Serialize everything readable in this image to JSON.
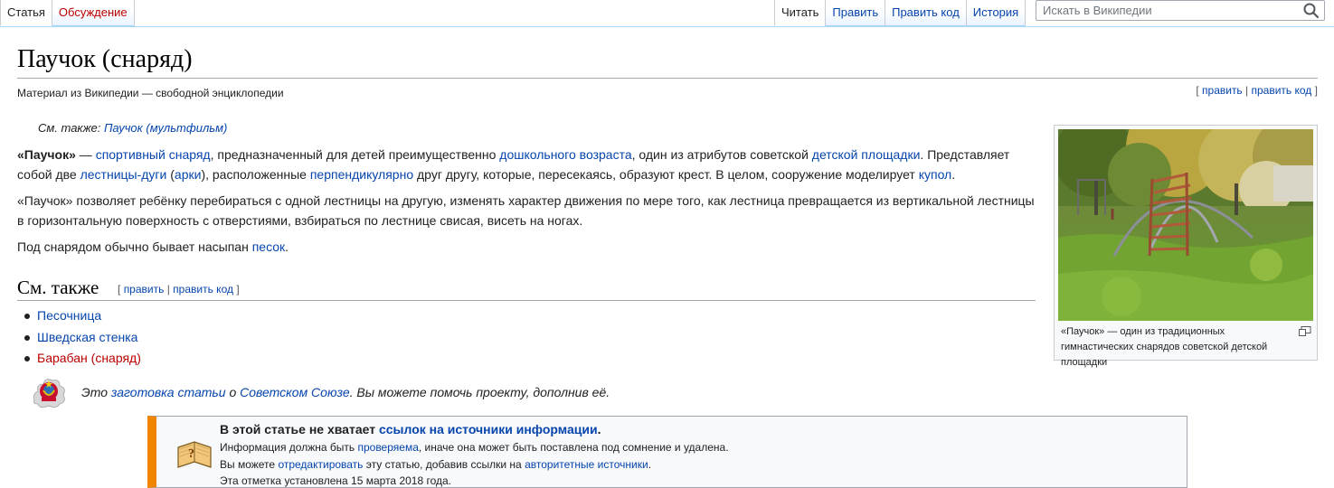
{
  "tabs_left": [
    {
      "label": "Статья",
      "selected": true
    },
    {
      "label": "Обсуждение",
      "selected": false
    }
  ],
  "tabs_right": [
    {
      "label": "Читать",
      "selected": true
    },
    {
      "label": "Править",
      "selected": false
    },
    {
      "label": "Править код",
      "selected": false
    },
    {
      "label": "История",
      "selected": false
    }
  ],
  "search": {
    "placeholder": "Искать в Википедии",
    "icon": "search-icon"
  },
  "article": {
    "title": "Паучок (снаряд)",
    "tagline": "Материал из Википедии — свободной энциклопедии",
    "edit_links": {
      "open": "[",
      "edit": "править",
      "sep": "|",
      "edit_code": "править код",
      "close": "]"
    },
    "hatnote": {
      "prefix": "См. также: ",
      "link": "Паучок (мультфильм)"
    },
    "p1": {
      "bold": "«Паучок»",
      "t1": " — ",
      "l1": "спортивный снаряд",
      "t2": ", предназначенный для детей преимущественно ",
      "l2": "дошкольного возраста",
      "t3": ", один из атрибутов советской ",
      "l3": "детской площадки",
      "t4": ". Представляет собой две ",
      "l4": "лестницы-дуги",
      "t5": " (",
      "l5": "арки",
      "t6": "), расположенные ",
      "l6": "перпендикулярно",
      "t7": " друг другу, которые, пересекаясь, образуют крест. В целом, сооружение моделирует ",
      "l7": "купол",
      "t8": "."
    },
    "p2": "«Паучок» позволяет ребёнку перебираться с одной лестницы на другую, изменять характер движения по мере того, как лестница превращается из вертикальной лестницы в горизонтальную поверхность с отверстиями, взбираться по лестнице свисая, висеть на ногах.",
    "p3": {
      "t1": "Под снарядом обычно бывает насыпан ",
      "l1": "песок",
      "t2": "."
    },
    "see_also": {
      "heading": "См. также",
      "items": [
        {
          "label": "Песочница",
          "exists": true
        },
        {
          "label": "Шведская стенка",
          "exists": true
        },
        {
          "label": "Барабан (снаряд)",
          "exists": false
        }
      ]
    },
    "stub": {
      "t1": "Это ",
      "l1": "заготовка статьи",
      "t2": " о ",
      "l2": "Советском Союзе",
      "t3": ". Вы можете помочь проекту, дополнив её."
    },
    "ambox": {
      "title_prefix": "В этой статье не хватает ",
      "title_link": "ссылок на источники информации",
      "title_suffix": ".",
      "line1_t1": "Информация должна быть ",
      "line1_link": "проверяема",
      "line1_t2": ", иначе она может быть поставлена под сомнение и удалена.",
      "line2_t1": "Вы можете ",
      "line2_link": "отредактировать",
      "line2_t2": " эту статью, добавив ссылки на ",
      "line2_link2": "авторитетные источники",
      "line2_t3": ".",
      "line3": "Эта отметка установлена 15 марта 2018 года."
    },
    "thumb": {
      "caption": "«Паучок» — один из традиционных гимнастических снарядов советской детской площадки",
      "enlarge_icon": "enlarge-icon"
    }
  },
  "colors": {
    "link": "#0645ad",
    "redlink": "#ba0000",
    "ambox_accent": "#f28500",
    "tab_border": "#a7d7f9"
  }
}
